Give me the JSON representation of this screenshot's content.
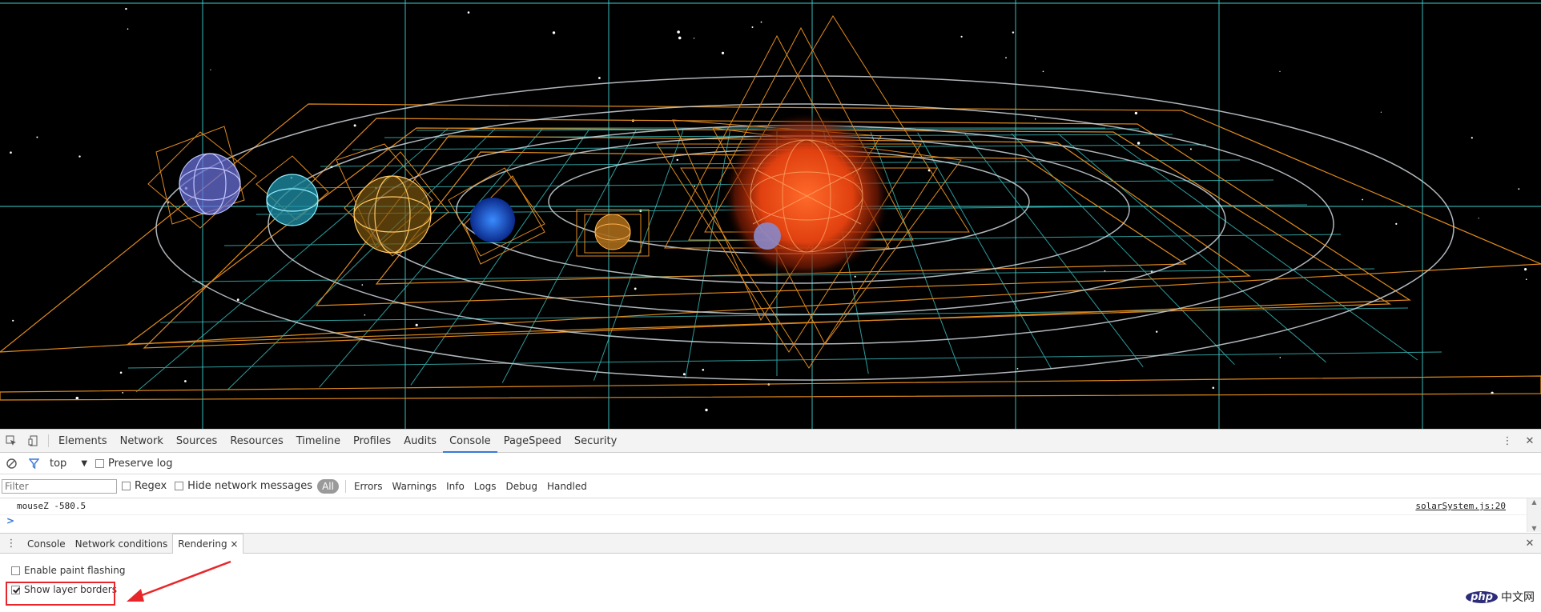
{
  "tabs": [
    "Elements",
    "Network",
    "Sources",
    "Resources",
    "Timeline",
    "Profiles",
    "Audits",
    "Console",
    "PageSpeed",
    "Security"
  ],
  "active_tab": "Console",
  "toolbar1": {
    "context": "top",
    "preserve_log": "Preserve log"
  },
  "toolbar2": {
    "filter_placeholder": "Filter",
    "regex": "Regex",
    "hide_network": "Hide network messages",
    "levels": [
      "All",
      "Errors",
      "Warnings",
      "Info",
      "Logs",
      "Debug",
      "Handled"
    ]
  },
  "console": {
    "message": "mouseZ -580.5",
    "source": "solarSystem.js:20",
    "prompt": ">"
  },
  "drawer": {
    "tabs": [
      "Console",
      "Network conditions",
      "Rendering"
    ],
    "active": "Rendering"
  },
  "rendering": {
    "paint_flashing": {
      "label": "Enable paint flashing",
      "checked": false
    },
    "layer_borders": {
      "label": "Show layer borders",
      "checked": true
    }
  },
  "watermark": {
    "logo": "php",
    "text": "中文网"
  },
  "colors": {
    "accent": "#3879d9",
    "highlight": "#e8262a",
    "layer_orange": "#e08a1e",
    "layer_cyan": "#3ecfcf"
  }
}
